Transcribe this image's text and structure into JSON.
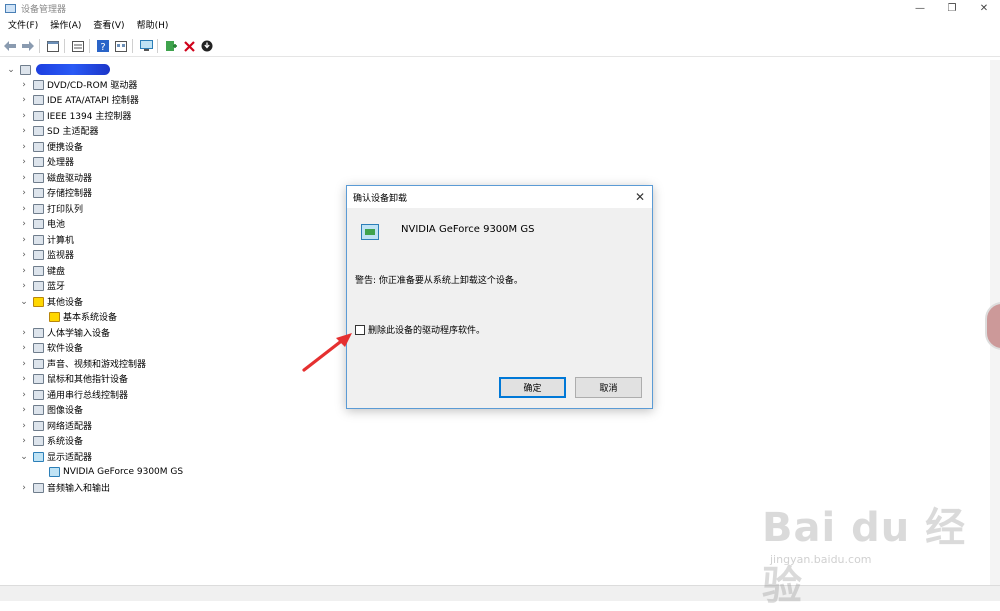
{
  "window": {
    "title": "设备管理器",
    "controls": [
      "—",
      "❐",
      "✕"
    ]
  },
  "menu": [
    "文件(F)",
    "操作(A)",
    "查看(V)",
    "帮助(H)"
  ],
  "toolbar": {
    "icons": [
      "back-arrow-icon",
      "forward-arrow-icon",
      "properties-icon",
      "help-icon",
      "view-icon",
      "monitor-icon",
      "add-driver-icon",
      "uninstall-icon",
      "download-icon"
    ],
    "uninstall_color": "#d0021b"
  },
  "tree": {
    "root_label": "",
    "items": [
      {
        "label": "DVD/CD-ROM 驱动器",
        "expanded": false
      },
      {
        "label": "IDE ATA/ATAPI 控制器",
        "expanded": false
      },
      {
        "label": "IEEE 1394 主控制器",
        "expanded": false
      },
      {
        "label": "SD 主适配器",
        "expanded": false
      },
      {
        "label": "便携设备",
        "expanded": false
      },
      {
        "label": "处理器",
        "expanded": false
      },
      {
        "label": "磁盘驱动器",
        "expanded": false
      },
      {
        "label": "存储控制器",
        "expanded": false
      },
      {
        "label": "打印队列",
        "expanded": false
      },
      {
        "label": "电池",
        "expanded": false
      },
      {
        "label": "计算机",
        "expanded": false
      },
      {
        "label": "监视器",
        "expanded": false
      },
      {
        "label": "键盘",
        "expanded": false
      },
      {
        "label": "蓝牙",
        "expanded": false
      },
      {
        "label": "其他设备",
        "expanded": true
      },
      {
        "label": "基本系统设备",
        "child": true
      },
      {
        "label": "人体学输入设备",
        "expanded": false
      },
      {
        "label": "软件设备",
        "expanded": false
      },
      {
        "label": "声音、视频和游戏控制器",
        "expanded": false
      },
      {
        "label": "鼠标和其他指针设备",
        "expanded": false
      },
      {
        "label": "通用串行总线控制器",
        "expanded": false
      },
      {
        "label": "图像设备",
        "expanded": false
      },
      {
        "label": "网络适配器",
        "expanded": false
      },
      {
        "label": "系统设备",
        "expanded": false
      },
      {
        "label": "显示适配器",
        "expanded": true
      },
      {
        "label": "NVIDIA GeForce 9300M GS",
        "child": true
      },
      {
        "label": "音频输入和输出",
        "expanded": false
      }
    ]
  },
  "dialog": {
    "title": "确认设备卸载",
    "close": "✕",
    "device_name": "NVIDIA GeForce 9300M GS",
    "warning": "警告: 你正准备要从系统上卸载这个设备。",
    "checkbox_label": "删除此设备的驱动程序软件。",
    "checkbox_checked": false,
    "ok_label": "确定",
    "cancel_label": "取消",
    "accent": "#0078d7"
  },
  "annotation": {
    "color": "#e53030"
  },
  "watermark": {
    "logo": "Bai du 经验",
    "url": "jingyan.baidu.com"
  }
}
